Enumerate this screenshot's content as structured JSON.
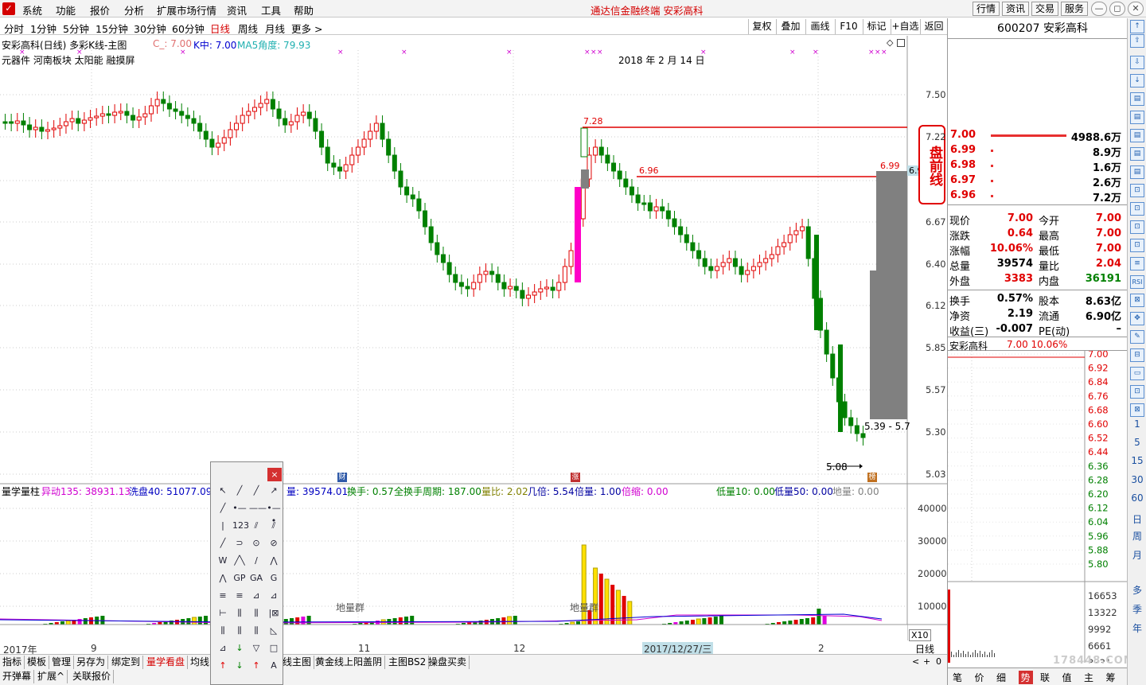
{
  "menu": {
    "items": [
      "系统",
      "功能",
      "报价",
      "分析",
      "扩展市场行情",
      "资讯",
      "工具",
      "帮助"
    ],
    "center_title": "通达信金融终端    安彩高科",
    "right_buttons": [
      "行情",
      "资讯",
      "交易",
      "服务"
    ]
  },
  "periods": {
    "items": [
      "分时",
      "1分钟",
      "5分钟",
      "15分钟",
      "30分钟",
      "60分钟",
      "日线",
      "周线",
      "月线",
      "更多 >"
    ],
    "active": "日线"
  },
  "tools": [
    "复权",
    "叠加",
    "画线",
    "F10",
    "标记",
    "+自选",
    "返回"
  ],
  "stock_header": {
    "code_name": "600207 安彩高科"
  },
  "main_info": {
    "title": "安彩高科(日线) 多彩K线-主图",
    "c_label": "C_: 7.00",
    "k_label": "K中: 7.00",
    "ma_label": "MA5角度: 79.93",
    "sectors": "元器件    河南板块  太阳能 融摸屏",
    "date_label": "2018 年 2 月 14 日",
    "price_728": "7.28",
    "price_696": "6.96",
    "price_699": "6.99",
    "price_69x": "6.96",
    "range_label": "5.39 - 5.7",
    "low_label": "5.08",
    "premarket": "盘前线"
  },
  "price_axis": [
    "7.50",
    "7.22",
    "6.95",
    "6.67",
    "6.40",
    "6.12",
    "5.85",
    "5.57",
    "5.30",
    "5.03"
  ],
  "volume_info": {
    "name": "量学量柱",
    "yidong": "异动135: 38931.13",
    "xipan": "洗盘40: 51077.09",
    "liang": "量: 39574.01",
    "huanshou": "换手: 0.57",
    "quan": "全换手周期: 187.00",
    "liangbi": "量比: 2.02",
    "jibei": "几倍: 5.54",
    "beiliang": "倍量: 1.00",
    "beisuo": "倍缩: 0.00",
    "diliang10": "低量10: 0.00",
    "diliang50": "低量50: 0.00",
    "diliang": "地量: 0.00",
    "dilq1": "地量群",
    "dilq2": "地量群",
    "x10": "X10"
  },
  "volume_axis": [
    "40000",
    "30000",
    "20000",
    "10000"
  ],
  "date_axis": {
    "y2017": "2017年",
    "m9": "9",
    "m11": "11",
    "m12": "12",
    "cursor": "2017/12/27/三",
    "m2": "2"
  },
  "bottom_tabs_row1": [
    "指标",
    "模板",
    "管理",
    "另存为",
    "绑定到",
    "量学看盘",
    "均线",
    "线主图",
    "黄金线上阳盖阴",
    "主图BS2",
    "操盘买卖"
  ],
  "bottom_tabs_row2": [
    "开弹幕",
    "扩展^",
    "关联报价"
  ],
  "bottom_right": {
    "label": "日线"
  },
  "order_book": [
    {
      "price": "7.00",
      "vol": "4988.6万",
      "bar": 0.95
    },
    {
      "price": "6.99",
      "vol": "8.9万",
      "bar": 0.02
    },
    {
      "price": "6.98",
      "vol": "1.6万",
      "bar": 0.01
    },
    {
      "price": "6.97",
      "vol": "2.6万",
      "bar": 0.01
    },
    {
      "price": "6.96",
      "vol": "7.2万",
      "bar": 0.02
    }
  ],
  "quote": [
    {
      "l1": "现价",
      "v1": "7.00",
      "l2": "今开",
      "v2": "7.00"
    },
    {
      "l1": "涨跌",
      "v1": "0.64",
      "l2": "最高",
      "v2": "7.00"
    },
    {
      "l1": "涨幅",
      "v1": "10.06%",
      "l2": "最低",
      "v2": "7.00"
    },
    {
      "l1": "总量",
      "v1": "39574",
      "l2": "量比",
      "v2": "2.04"
    },
    {
      "l1": "外盘",
      "v1": "3383",
      "l2": "内盘",
      "v2": "36191"
    }
  ],
  "fundamentals": [
    {
      "l1": "换手",
      "v1": "0.57%",
      "l2": "股本",
      "v2": "8.63亿"
    },
    {
      "l1": "净资",
      "v1": "2.19",
      "l2": "流通",
      "v2": "6.90亿"
    },
    {
      "l1": "收益(三)",
      "v1": "-0.007",
      "l2": "PE(动)",
      "v2": "–"
    }
  ],
  "mini_chart": {
    "title": "安彩高科",
    "title_vals": "7.00  10.06%",
    "price_ticks": [
      "7.00",
      "6.92",
      "6.84",
      "6.76",
      "6.68",
      "6.60",
      "6.52",
      "6.44",
      "6.36",
      "6.28",
      "6.20",
      "6.12",
      "6.04",
      "5.96",
      "5.88",
      "5.80"
    ],
    "vol_ticks": [
      "16653",
      "13322",
      "9992",
      "6661",
      "3331"
    ]
  },
  "right_bottom_tabs": [
    "笔",
    "价",
    "细",
    "势",
    "联",
    "值",
    "主",
    "筹"
  ],
  "sidebar": {
    "labels": [
      "1",
      "5",
      "15",
      "30",
      "60",
      "日",
      "周",
      "月",
      "多",
      "季",
      "年"
    ]
  },
  "watermark": "178448.COM"
}
